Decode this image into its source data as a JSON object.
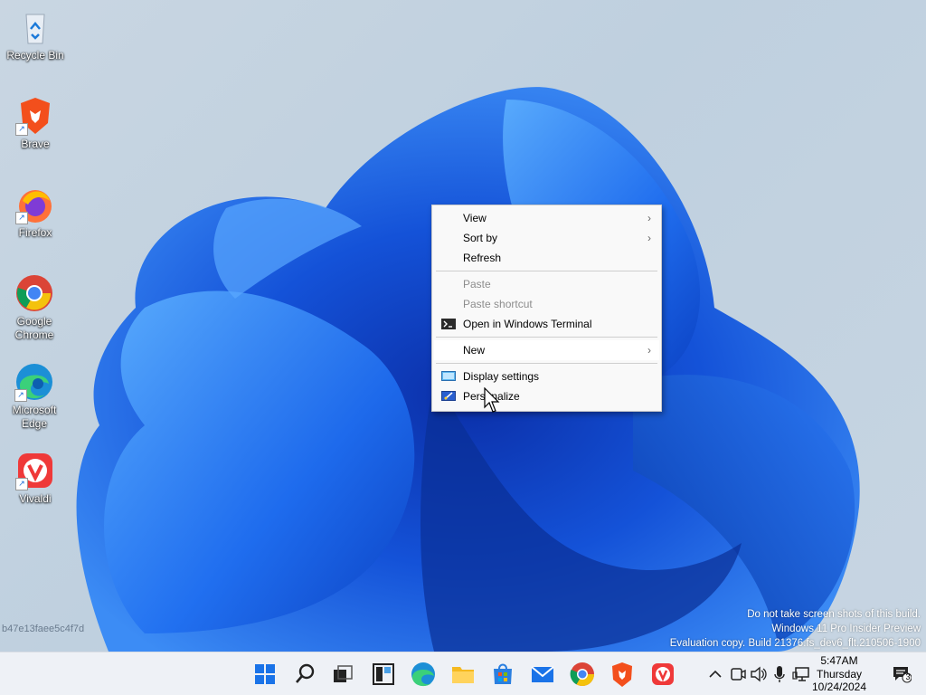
{
  "desktop_icons": [
    {
      "label": "Recycle Bin",
      "icon": "recycle-bin-icon"
    },
    {
      "label": "Brave",
      "icon": "brave-icon"
    },
    {
      "label": "Firefox",
      "icon": "firefox-icon"
    },
    {
      "label": "Google Chrome",
      "icon": "chrome-icon"
    },
    {
      "label": "Microsoft Edge",
      "icon": "edge-icon"
    },
    {
      "label": "Vivaldi",
      "icon": "vivaldi-icon"
    }
  ],
  "context_menu": {
    "items": [
      {
        "label": "View",
        "submenu": true
      },
      {
        "label": "Sort by",
        "submenu": true
      },
      {
        "label": "Refresh"
      },
      {
        "label": "Paste",
        "disabled": true
      },
      {
        "label": "Paste shortcut",
        "disabled": true
      },
      {
        "label": "Open in Windows Terminal",
        "icon": "terminal-icon"
      },
      {
        "label": "New",
        "submenu": true
      },
      {
        "label": "Display settings",
        "icon": "display-icon"
      },
      {
        "label": "Personalize",
        "icon": "personalize-icon"
      }
    ]
  },
  "watermark": {
    "left": "b47e13faee5c4f7d",
    "line1": "Do not take screen shots of this build.",
    "line2": "Windows 11 Pro Insider Preview",
    "line3": "Evaluation copy. Build 21376.fs_dev6_flt.210506-1900"
  },
  "taskbar": {
    "apps": [
      "start-icon",
      "search-icon",
      "task-view-icon",
      "widgets-icon",
      "edge-icon",
      "file-explorer-icon",
      "store-icon",
      "mail-icon",
      "chrome-icon",
      "brave-icon",
      "vivaldi-icon"
    ],
    "tray": [
      "chevron-up-icon",
      "meet-now-icon",
      "volume-icon",
      "microphone-icon",
      "network-icon"
    ],
    "clock": {
      "time": "5:47AM",
      "day": "Thursday",
      "date": "10/24/2024"
    },
    "notification_count": "3"
  },
  "colors": {
    "bloom": "#1a5fe0",
    "bloom_light": "#4aa3ff",
    "taskbar": "#eef1f6",
    "menu": "#f9f9f9"
  }
}
